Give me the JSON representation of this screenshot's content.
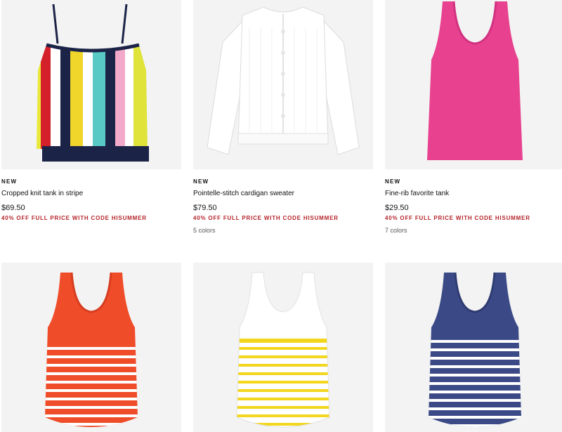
{
  "products": [
    {
      "badge": "NEW",
      "name": "Cropped knit tank in stripe",
      "price": "$69.50",
      "promo": "40% OFF FULL PRICE WITH CODE HISUMMER",
      "colors": "",
      "image": "striped-knit-tank-image"
    },
    {
      "badge": "NEW",
      "name": "Pointelle-stitch cardigan sweater",
      "price": "$79.50",
      "promo": "40% OFF FULL PRICE WITH CODE HISUMMER",
      "colors": "5 colors",
      "image": "white-cardigan-image"
    },
    {
      "badge": "NEW",
      "name": "Fine-rib favorite tank",
      "price": "$29.50",
      "promo": "40% OFF FULL PRICE WITH CODE HISUMMER",
      "colors": "7 colors",
      "image": "pink-tank-image"
    },
    {
      "image": "orange-striped-tank-image"
    },
    {
      "image": "yellow-striped-tank-image"
    },
    {
      "image": "navy-striped-tank-image"
    }
  ],
  "colors": {
    "promo_red": "#b5252b",
    "image_bg": "#f3f3f3",
    "tank_orange": "#ef4c2a",
    "tank_yellow": "#f3d61e",
    "tank_navy": "#3b4a86",
    "tank_pink": "#e8418f"
  }
}
